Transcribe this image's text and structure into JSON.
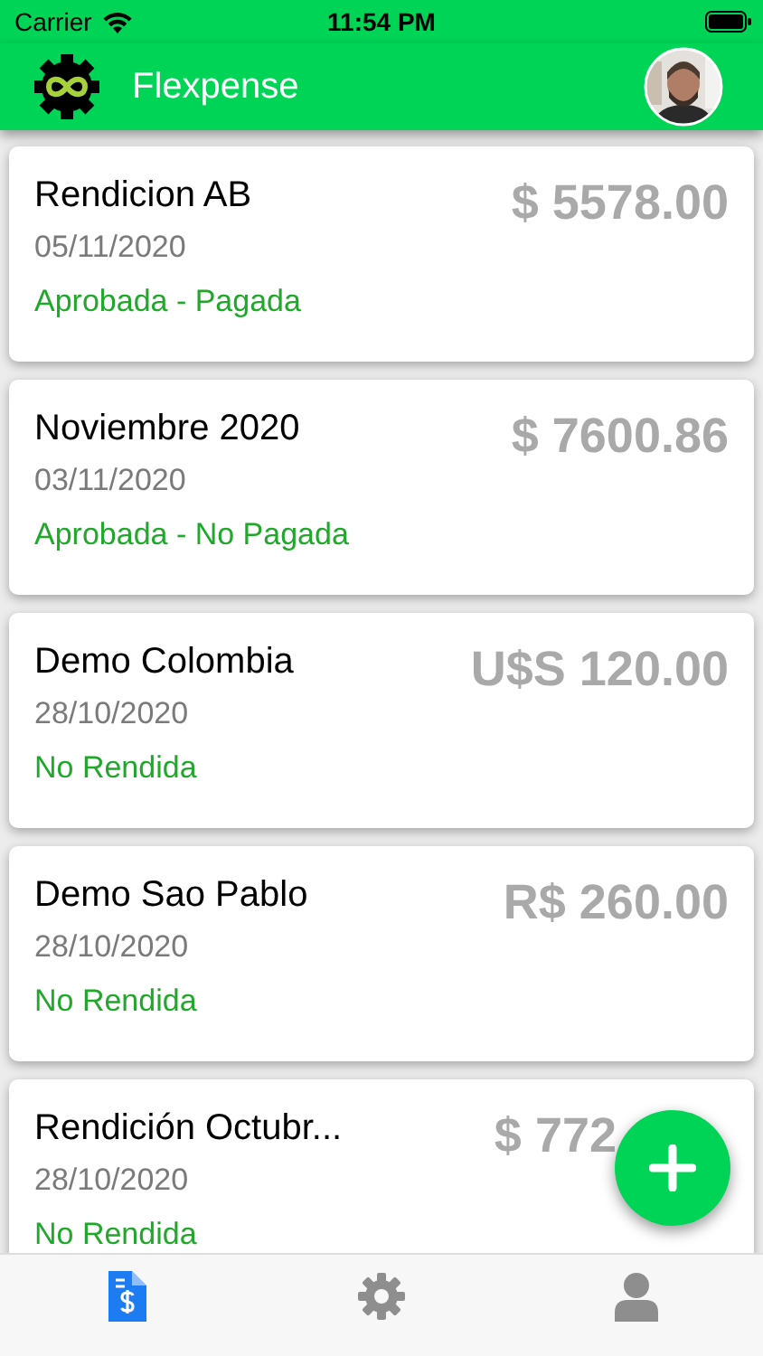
{
  "status_bar": {
    "carrier": "Carrier",
    "time": "11:54 PM"
  },
  "header": {
    "title": "Flexpense"
  },
  "reports": [
    {
      "title": "Rendicion AB",
      "date": "05/11/2020",
      "status": "Aprobada - Pagada",
      "amount": "$ 5578.00"
    },
    {
      "title": "Noviembre 2020",
      "date": "03/11/2020",
      "status": "Aprobada - No Pagada",
      "amount": "$ 7600.86"
    },
    {
      "title": "Demo Colombia",
      "date": "28/10/2020",
      "status": "No Rendida",
      "amount": "U$S 120.00"
    },
    {
      "title": "Demo Sao Pablo",
      "date": "28/10/2020",
      "status": "No Rendida",
      "amount": "R$ 260.00"
    },
    {
      "title": "Rendición Octubr...",
      "date": "28/10/2020",
      "status": "No Rendida",
      "amount": "$ 772"
    }
  ],
  "tabs": [
    {
      "kind": "reports",
      "selected": true
    },
    {
      "kind": "settings",
      "selected": false
    },
    {
      "kind": "profile",
      "selected": false
    }
  ]
}
